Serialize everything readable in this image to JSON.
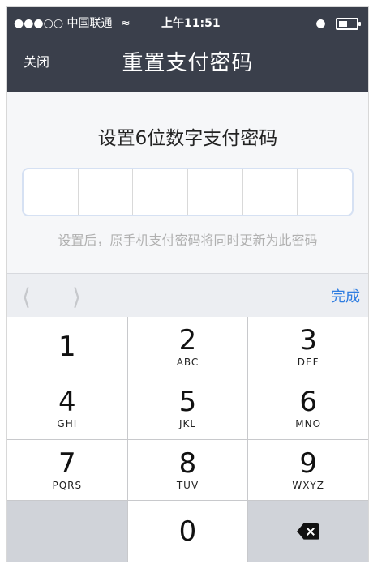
{
  "status_bar": {
    "carrier": "●●●○○ 中国联通",
    "wifi_icon": "wifi-icon",
    "time": "上午11:51",
    "lock_icon": "orientation-lock-icon",
    "battery_icon": "battery-icon"
  },
  "nav": {
    "close_label": "关闭",
    "title": "重置支付密码"
  },
  "content": {
    "heading": "设置6位数字支付密码",
    "pin_length": 6,
    "hint": "设置后，原手机支付密码将同时更新为此密码"
  },
  "toolbar": {
    "prev_icon": "chevron-left-icon",
    "next_icon": "chevron-right-icon",
    "done_label": "完成",
    "accent": "#2f7de1"
  },
  "keypad": {
    "keys": [
      {
        "num": "1",
        "letters": ""
      },
      {
        "num": "2",
        "letters": "ABC"
      },
      {
        "num": "3",
        "letters": "DEF"
      },
      {
        "num": "4",
        "letters": "GHI"
      },
      {
        "num": "5",
        "letters": "JKL"
      },
      {
        "num": "6",
        "letters": "MNO"
      },
      {
        "num": "7",
        "letters": "PQRS"
      },
      {
        "num": "8",
        "letters": "TUV"
      },
      {
        "num": "9",
        "letters": "WXYZ"
      },
      {
        "num": "",
        "letters": ""
      },
      {
        "num": "0",
        "letters": ""
      },
      {
        "num": "",
        "letters": "",
        "icon": "backspace-icon"
      }
    ]
  }
}
